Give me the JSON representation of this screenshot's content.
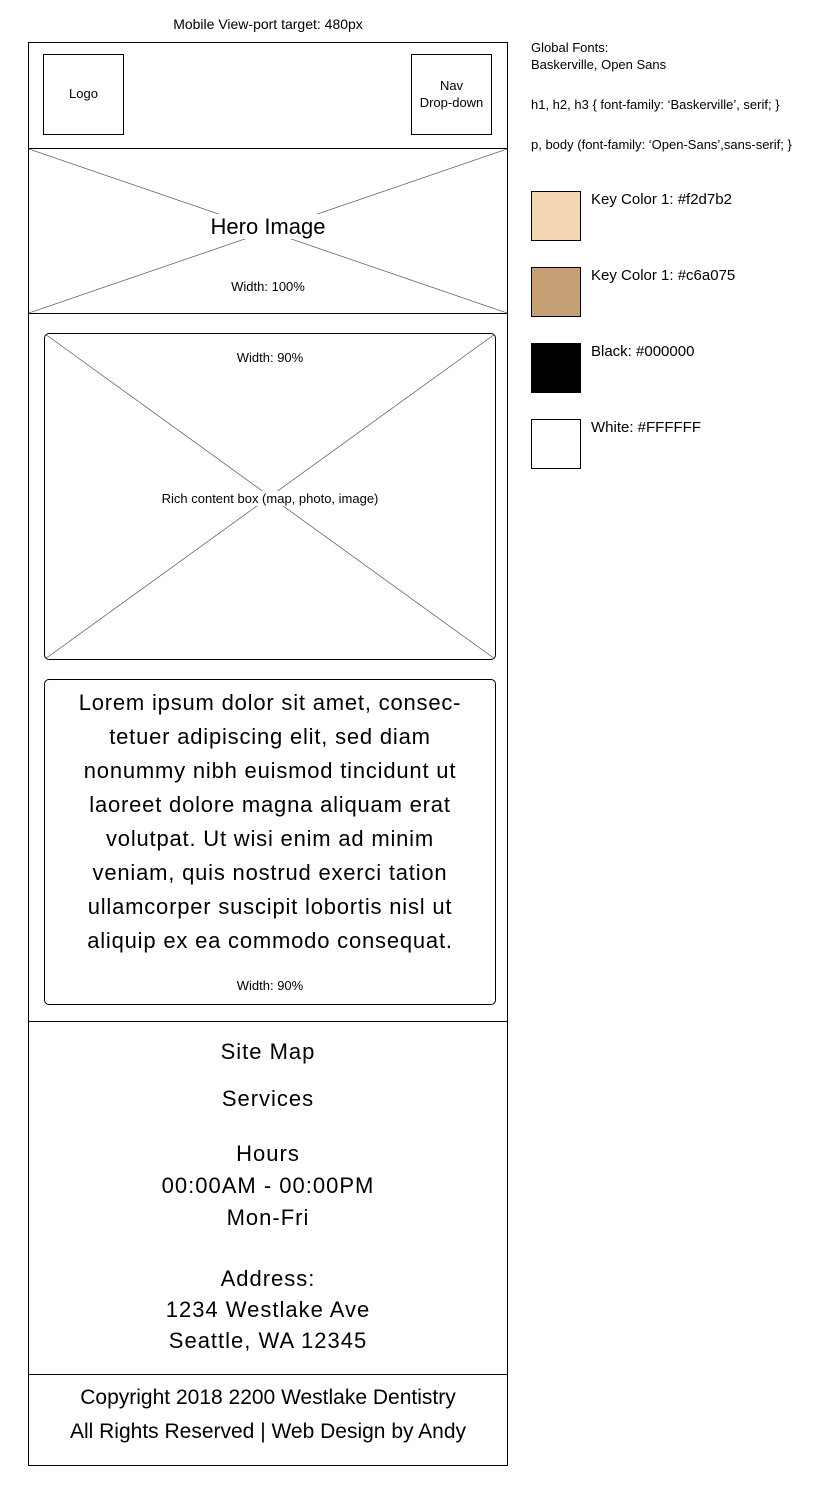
{
  "viewport_title": "Mobile View-port target: 480px",
  "header": {
    "logo_label": "Logo",
    "nav_label": "Nav\nDrop-down"
  },
  "hero": {
    "title": "Hero Image",
    "width_note": "Width: 100%"
  },
  "rich_content": {
    "width_note": "Width: 90%",
    "label": "Rich content box (map, photo, image)"
  },
  "text_block": {
    "lines": [
      "Lorem ipsum dolor sit amet, consec-",
      "tetuer adipiscing elit, sed diam",
      "nonummy nibh euismod tincidunt ut",
      "laoreet dolore magna aliquam erat",
      "volutpat. Ut wisi enim ad minim",
      "veniam, quis nostrud exerci tation",
      "ullamcorper suscipit lobortis nisl ut",
      "aliquip ex ea commodo consequat."
    ],
    "width_note": "Width: 90%"
  },
  "footer": {
    "site_map": "Site Map",
    "services": "Services",
    "hours_title": "Hours",
    "hours_time": "00:00AM - 00:00PM",
    "hours_days": "Mon-Fri",
    "address_title": "Address:",
    "address_line1": "1234 Westlake Ave",
    "address_line2": "Seattle, WA 12345"
  },
  "copyright": {
    "line1": "Copyright 2018 2200 Westlake Dentistry",
    "line2": "All Rights Reserved  |  Web Design by Andy"
  },
  "style_guide": {
    "fonts_heading": "Global Fonts:",
    "fonts_list": "Baskerville, Open Sans",
    "heading_rule": "h1, h2, h3 { font-family: ‘Baskerville’, serif; }",
    "body_rule": "p, body (font-family: ‘Open-Sans’,sans-serif; }",
    "swatches": [
      {
        "label": "Key Color 1: #f2d7b2",
        "color": "#f2d7b2"
      },
      {
        "label": "Key Color 1: #c6a075",
        "color": "#c6a075"
      },
      {
        "label": "Black: #000000",
        "color": "#000000"
      },
      {
        "label": "White: #FFFFFF",
        "color": "#FFFFFF"
      }
    ]
  }
}
